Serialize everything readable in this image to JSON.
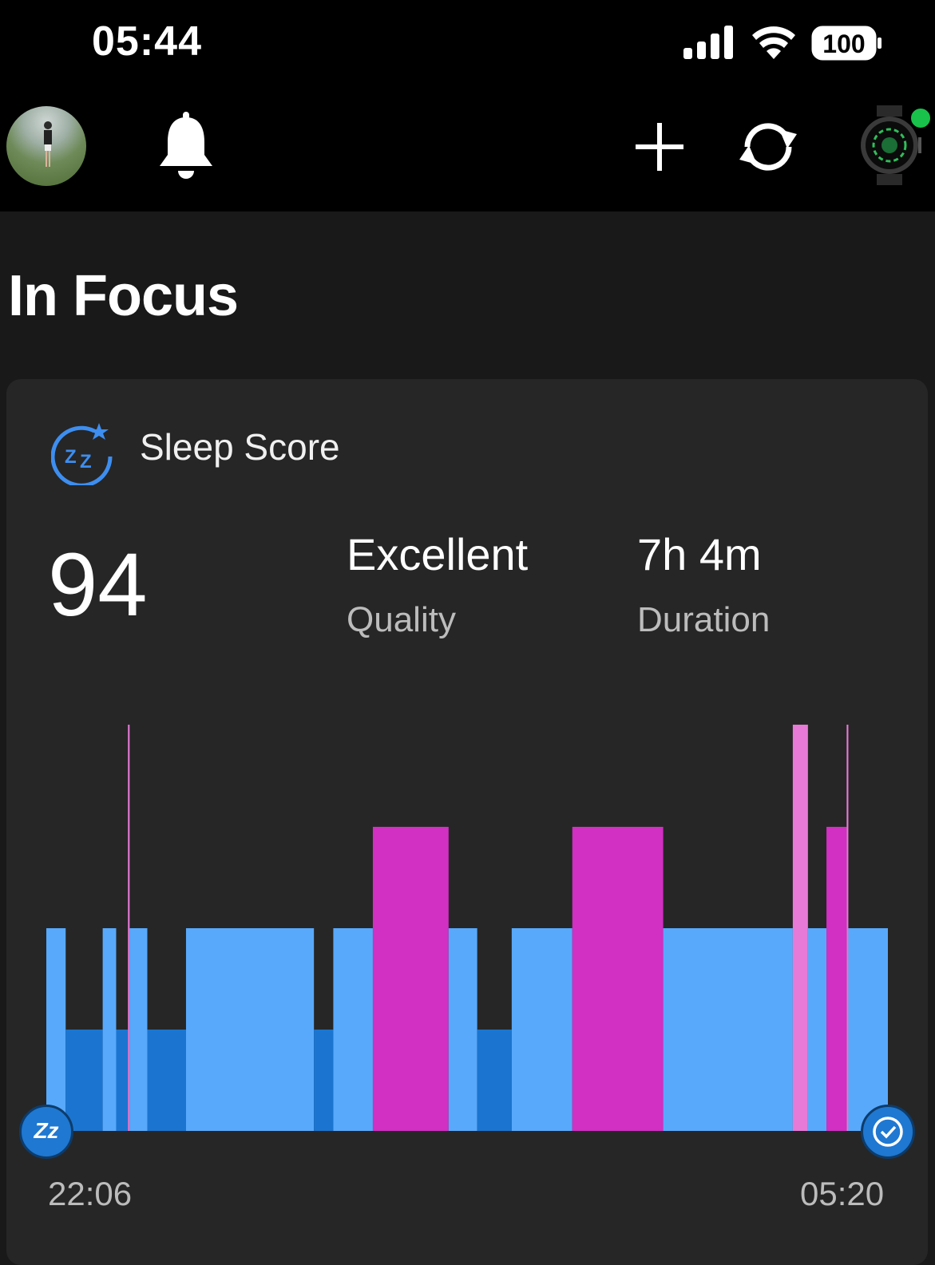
{
  "status_bar": {
    "time": "05:44",
    "battery": "100"
  },
  "top_bar": {
    "icons": [
      "avatar",
      "bell-icon",
      "plus-icon",
      "sync-icon",
      "watch-device-icon"
    ],
    "device_connected_color": "#19c24a"
  },
  "section": {
    "title": "In Focus"
  },
  "sleep_card": {
    "title": "Sleep Score",
    "score": "94",
    "quality_value": "Excellent",
    "quality_label": "Quality",
    "duration_value": "7h 4m",
    "duration_label": "Duration",
    "start_time": "22:06",
    "end_time": "05:20",
    "start_icon_text": "Zz"
  },
  "chart_data": {
    "type": "bar",
    "x_start": "22:06",
    "x_end": "05:20",
    "colors": {
      "awake": "#e77ad6",
      "rem": "#d22fc3",
      "light": "#58a9fc",
      "deep": "#1b75d0"
    },
    "levels": [
      "deep",
      "light",
      "rem",
      "awake"
    ],
    "segments": [
      {
        "stage": "light",
        "start": 0.0,
        "end": 0.023
      },
      {
        "stage": "deep",
        "start": 0.023,
        "end": 0.067
      },
      {
        "stage": "light",
        "start": 0.067,
        "end": 0.083
      },
      {
        "stage": "deep",
        "start": 0.083,
        "end": 0.097
      },
      {
        "stage": "awake",
        "start": 0.097,
        "end": 0.099
      },
      {
        "stage": "light",
        "start": 0.099,
        "end": 0.12
      },
      {
        "stage": "deep",
        "start": 0.12,
        "end": 0.166
      },
      {
        "stage": "light",
        "start": 0.166,
        "end": 0.318
      },
      {
        "stage": "deep",
        "start": 0.318,
        "end": 0.341
      },
      {
        "stage": "light",
        "start": 0.341,
        "end": 0.388
      },
      {
        "stage": "rem",
        "start": 0.388,
        "end": 0.478
      },
      {
        "stage": "light",
        "start": 0.478,
        "end": 0.512
      },
      {
        "stage": "deep",
        "start": 0.512,
        "end": 0.553
      },
      {
        "stage": "light",
        "start": 0.553,
        "end": 0.625
      },
      {
        "stage": "rem",
        "start": 0.625,
        "end": 0.733
      },
      {
        "stage": "light",
        "start": 0.733,
        "end": 0.887
      },
      {
        "stage": "awake",
        "start": 0.887,
        "end": 0.905
      },
      {
        "stage": "light",
        "start": 0.905,
        "end": 0.927
      },
      {
        "stage": "rem",
        "start": 0.927,
        "end": 0.951
      },
      {
        "stage": "awake",
        "start": 0.951,
        "end": 0.953
      },
      {
        "stage": "light",
        "start": 0.953,
        "end": 1.0
      }
    ]
  }
}
